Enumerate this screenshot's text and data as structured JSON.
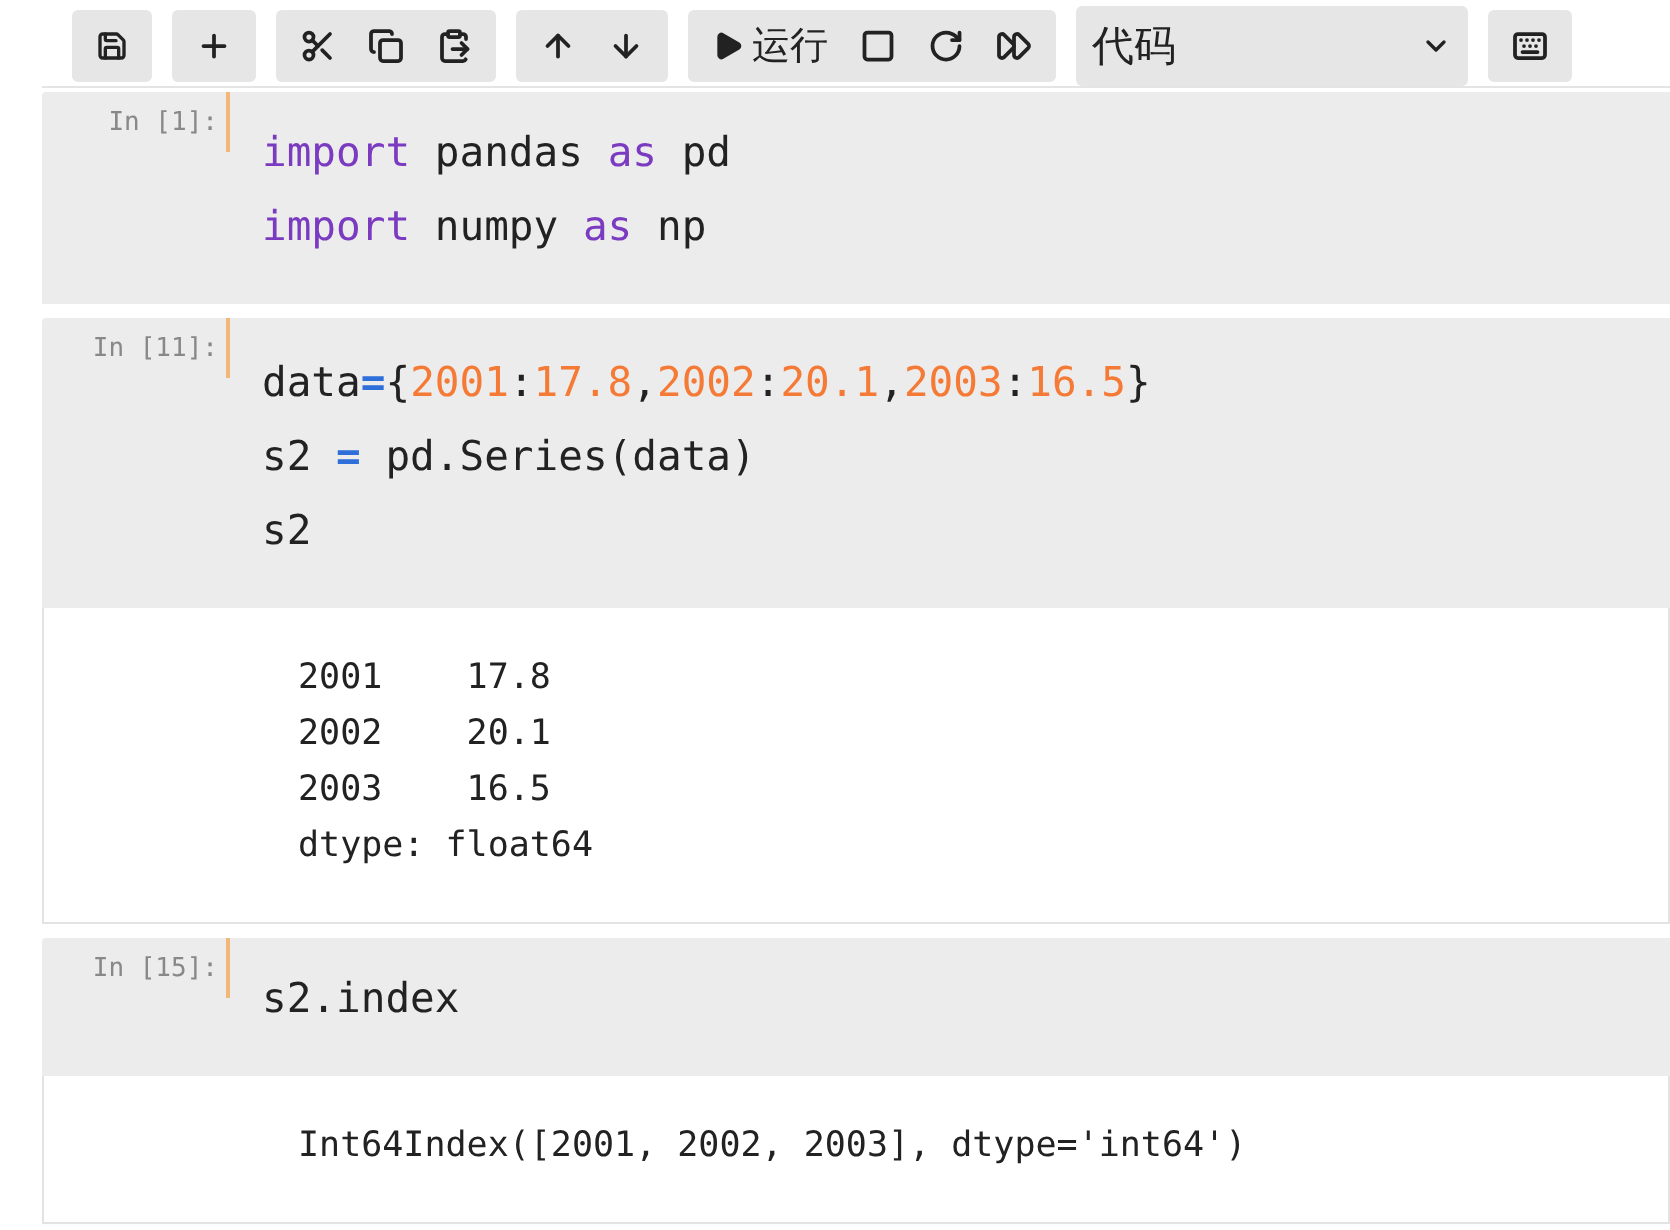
{
  "toolbar": {
    "run_label": "运行",
    "cell_type": "代码"
  },
  "cells": [
    {
      "prompt": "In [1]:",
      "input": [
        [
          {
            "kind": "keyword",
            "text": "import"
          },
          {
            "kind": "plain",
            "text": " pandas "
          },
          {
            "kind": "keyword",
            "text": "as"
          },
          {
            "kind": "plain",
            "text": " pd"
          }
        ],
        [
          {
            "kind": "keyword",
            "text": "import"
          },
          {
            "kind": "plain",
            "text": " numpy "
          },
          {
            "kind": "keyword",
            "text": "as"
          },
          {
            "kind": "plain",
            "text": " np"
          }
        ]
      ]
    },
    {
      "prompt": "In [11]:",
      "input": [
        [
          {
            "kind": "plain",
            "text": "data"
          },
          {
            "kind": "operator",
            "text": "="
          },
          {
            "kind": "plain",
            "text": "{"
          },
          {
            "kind": "number",
            "text": "2001"
          },
          {
            "kind": "plain",
            "text": ":"
          },
          {
            "kind": "number",
            "text": "17.8"
          },
          {
            "kind": "plain",
            "text": ","
          },
          {
            "kind": "number",
            "text": "2002"
          },
          {
            "kind": "plain",
            "text": ":"
          },
          {
            "kind": "number",
            "text": "20.1"
          },
          {
            "kind": "plain",
            "text": ","
          },
          {
            "kind": "number",
            "text": "2003"
          },
          {
            "kind": "plain",
            "text": ":"
          },
          {
            "kind": "number",
            "text": "16.5"
          },
          {
            "kind": "plain",
            "text": "}"
          }
        ],
        [
          {
            "kind": "plain",
            "text": "s2 "
          },
          {
            "kind": "operator",
            "text": "="
          },
          {
            "kind": "plain",
            "text": " pd.Series(data)"
          }
        ],
        [
          {
            "kind": "plain",
            "text": "s2"
          }
        ]
      ],
      "output": [
        "2001    17.8",
        "2002    20.1",
        "2003    16.5",
        "dtype: float64"
      ]
    },
    {
      "prompt": "In [15]:",
      "input": [
        [
          {
            "kind": "plain",
            "text": "s2.index"
          }
        ]
      ],
      "output": [
        "Int64Index([2001, 2002, 2003], dtype='int64')"
      ]
    }
  ]
}
